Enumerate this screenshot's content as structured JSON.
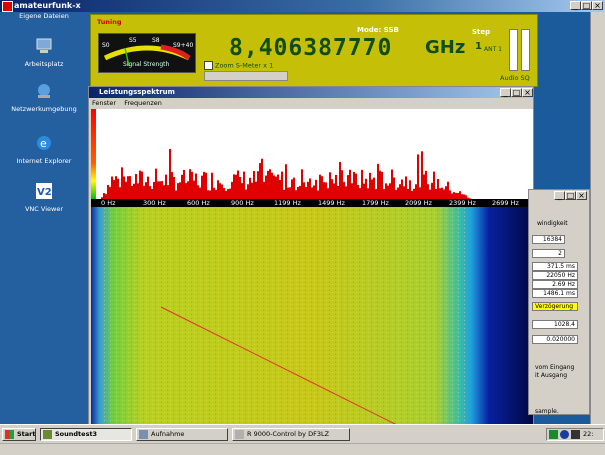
{
  "outer_window": {
    "title": "amateurfunk-x"
  },
  "desktop": {
    "top_label": "Eigene Dateien",
    "icons": [
      {
        "label": "Arbeitsplatz",
        "icon": "computer-icon"
      },
      {
        "label": "Netzwerkumgebung",
        "icon": "network-icon"
      },
      {
        "label": "Internet Explorer",
        "icon": "ie-icon"
      },
      {
        "label": "VNC Viewer",
        "icon": "vnc-icon"
      }
    ]
  },
  "tuning": {
    "label": "Tuning",
    "frequency": "8,406387770",
    "unit": "GHz",
    "mode": "Mode: SSB",
    "step_label": "Step",
    "step_value": "1",
    "antenna": "ANT 1",
    "audio_label": "Audio SQ",
    "zoom_label": "Zoom S-Meter x 1",
    "meter": {
      "scale": [
        "S0",
        "S5",
        "S8",
        "S9+40"
      ],
      "caption": "Signal Strength"
    }
  },
  "spectrum_window": {
    "title": "Leistungsspektrum",
    "menu": [
      "Fenster",
      "Frequenzen"
    ],
    "axis_ticks": [
      "0 Hz",
      "300 Hz",
      "600 Hz",
      "900 Hz",
      "1199 Hz",
      "1499 Hz",
      "1799 Hz",
      "2099 Hz",
      "2399 Hz",
      "2699 Hz"
    ]
  },
  "dialog": {
    "heading": "windigkeit",
    "spin1": "16384",
    "spin2": "2",
    "values": [
      "371.5 ms",
      "22050 Hz",
      "2.69 Hz",
      "1486.1 ms"
    ],
    "highlight": "Verzögerung",
    "field1": "1028.4",
    "field2": "0.020000",
    "text1": "vom Eingang",
    "text2": "it Ausgang",
    "text3": "sample."
  },
  "taskbar": {
    "start": "Start",
    "buttons": [
      "Soundtest3",
      "Aufnahme",
      "R 9000-Control by DF3LZ"
    ],
    "clock": "22:"
  },
  "colors": {
    "tuning_bg": "#c5c007",
    "frequency_text": "#0f4d12",
    "spectrum_red": "#e00000",
    "title_bar": "#0a246a"
  }
}
